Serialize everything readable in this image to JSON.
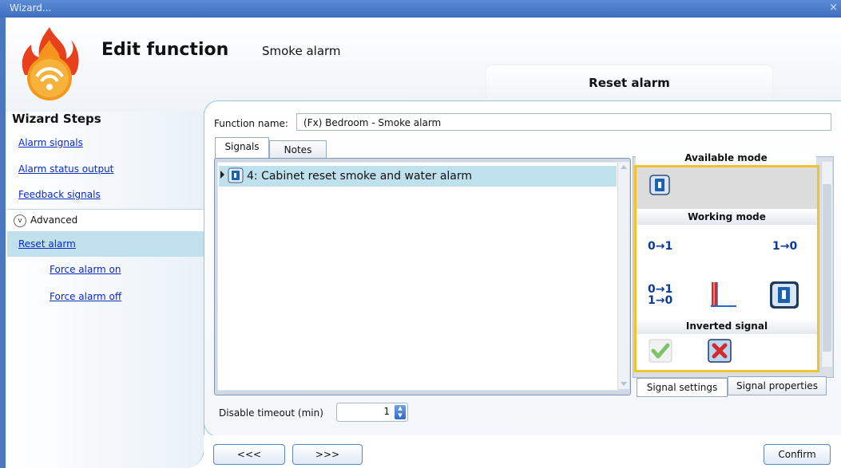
{
  "window": {
    "title": "Wizard...",
    "close_glyph": "×"
  },
  "header": {
    "title": "Edit function",
    "subtitle": "Smoke alarm",
    "active_step_tab": "Reset alarm"
  },
  "steps": {
    "title": "Wizard Steps",
    "items": [
      {
        "label": "Alarm signals"
      },
      {
        "label": "Alarm status output"
      },
      {
        "label": "Feedback signals"
      }
    ],
    "advanced": {
      "label": "Advanced"
    },
    "sub_items": [
      {
        "label": "Reset alarm"
      },
      {
        "label": "Force alarm on"
      },
      {
        "label": "Force alarm off"
      }
    ]
  },
  "function_name": {
    "label": "Function name:",
    "value": "(Fx) Bedroom - Smoke alarm"
  },
  "tabs": {
    "signals": "Signals",
    "notes": "Notes"
  },
  "signal_list": {
    "rows": [
      {
        "label": "4: Cabinet reset smoke and water alarm"
      }
    ]
  },
  "side_panel": {
    "available_mode": "Available mode",
    "working_mode": "Working mode",
    "inverted_signal": "Inverted signal",
    "mode_0_to_1": "0→1",
    "mode_1_to_0": "1→0",
    "mode_both_top": "0→1",
    "mode_both_bottom": "1→0",
    "tabs": {
      "settings": "Signal settings",
      "properties": "Signal properties"
    }
  },
  "disable_timeout": {
    "label": "Disable timeout (min)",
    "value": "1"
  },
  "footer": {
    "back": "<<<",
    "next": ">>>",
    "confirm": "Confirm"
  },
  "colors": {
    "accent_blue": "#4a76c2",
    "highlight": "#f2c12e",
    "selection": "#bfe1ee"
  }
}
